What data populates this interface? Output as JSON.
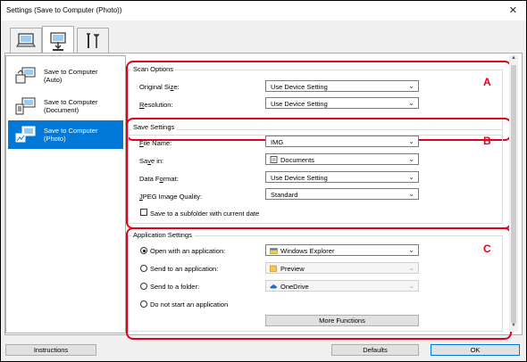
{
  "window": {
    "title": "Settings (Save to Computer (Photo))"
  },
  "tabs": [
    {
      "icon": "scan-to-computer-icon"
    },
    {
      "icon": "save-to-pc-icon"
    },
    {
      "icon": "tools-icon"
    }
  ],
  "sidebar": {
    "items": [
      {
        "label_line1": "Save to Computer",
        "label_line2": "(Auto)"
      },
      {
        "label_line1": "Save to Computer",
        "label_line2": "(Document)"
      },
      {
        "label_line1": "Save to Computer",
        "label_line2": "(Photo)"
      }
    ],
    "selected_index": 2
  },
  "scan_options": {
    "title": "Scan Options",
    "original_size_label": "Original Size:",
    "original_size_value": "Use Device Setting",
    "resolution_label": "Resolution:",
    "resolution_value": "Use Device Setting",
    "marker": "A"
  },
  "save_settings": {
    "title": "Save Settings",
    "file_name_label": "File Name:",
    "file_name_value": "IMG",
    "save_in_label": "Save in:",
    "save_in_value": "Documents",
    "data_format_label": "Data Format:",
    "data_format_value": "Use Device Setting",
    "jpeg_quality_label": "JPEG Image Quality:",
    "jpeg_quality_value": "Standard",
    "subfolder_label": "Save to a subfolder with current date",
    "marker": "B"
  },
  "application_settings": {
    "title": "Application Settings",
    "open_app_label": "Open with an application:",
    "open_app_value": "Windows Explorer",
    "send_app_label": "Send to an application:",
    "send_app_value": "Preview",
    "send_folder_label": "Send to a folder:",
    "send_folder_value": "OneDrive",
    "do_not_start_label": "Do not start an application",
    "more_functions_label": "More Functions",
    "marker": "C"
  },
  "footer": {
    "instructions_label": "Instructions",
    "defaults_label": "Defaults",
    "ok_label": "OK"
  },
  "colors": {
    "highlight_red": "#e4001b",
    "selection_blue": "#0078d7"
  }
}
